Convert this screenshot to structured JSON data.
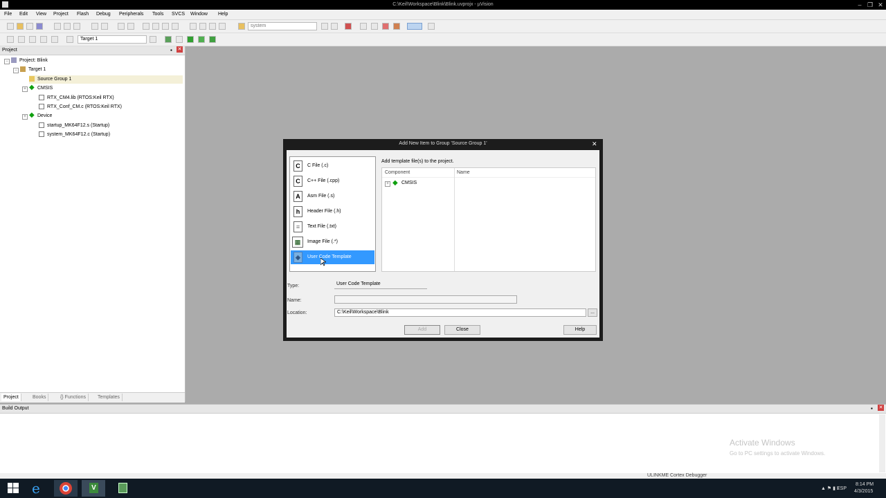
{
  "window": {
    "title": "C:\\Keil\\Workspace\\Blink\\Blink.uvprojx - µVision",
    "controls": [
      "–",
      "❐",
      "✕"
    ]
  },
  "menu": [
    "File",
    "Edit",
    "View",
    "Project",
    "Flash",
    "Debug",
    "Peripherals",
    "Tools",
    "SVCS",
    "Window",
    "Help"
  ],
  "toolbar": {
    "find_value": "system",
    "target_value": "Target 1"
  },
  "project_panel": {
    "title": "Project",
    "tree": {
      "project": "Project: Blink",
      "target": "Target 1",
      "source_group": "Source Group 1",
      "cmsis": "CMSIS",
      "cmsis_files": [
        "RTX_CM4.lib (RTOS:Keil RTX)",
        "RTX_Conf_CM.c (RTOS:Keil RTX)"
      ],
      "device": "Device",
      "device_files": [
        "startup_MK64F12.s (Startup)",
        "system_MK64F12.c (Startup)"
      ]
    },
    "tabs": [
      "Project",
      "Books",
      "{} Functions",
      "Templates"
    ]
  },
  "build_output": {
    "title": "Build Output",
    "watermark_title": "Activate Windows",
    "watermark_text": "Go to PC settings to activate Windows."
  },
  "statusbar": {
    "debugger": "ULINKME Cortex Debugger"
  },
  "dialog": {
    "title": "Add New Item to Group 'Source Group 1'",
    "file_types": [
      {
        "icon": "C",
        "label": "C File (.c)"
      },
      {
        "icon": "C",
        "label": "C++ File (.cpp)"
      },
      {
        "icon": "A",
        "label": "Asm File (.s)"
      },
      {
        "icon": "h",
        "label": "Header File (.h)"
      },
      {
        "icon": "≡",
        "label": "Text File (.txt)"
      },
      {
        "icon": "▦",
        "label": "Image File (.*)"
      },
      {
        "icon": "◈",
        "label": "User Code Template"
      }
    ],
    "hint": "Add template file(s) to the project.",
    "columns": [
      "Component",
      "Name"
    ],
    "component": "CMSIS",
    "labels": {
      "type": "Type:",
      "name": "Name:",
      "location": "Location:"
    },
    "type_value": "User Code Template",
    "name_value": "",
    "location_value": "C:\\Keil\\Workspace\\Blink",
    "buttons": {
      "add": "Add",
      "close": "Close",
      "help": "Help",
      "browse": "..."
    }
  },
  "taskbar": {
    "time": "8:14 PM",
    "date": "4/3/2015",
    "lang": "ESP"
  },
  "colors": {
    "selection": "#3399ff",
    "workspace": "#ababab",
    "taskbar": "#101a24"
  }
}
